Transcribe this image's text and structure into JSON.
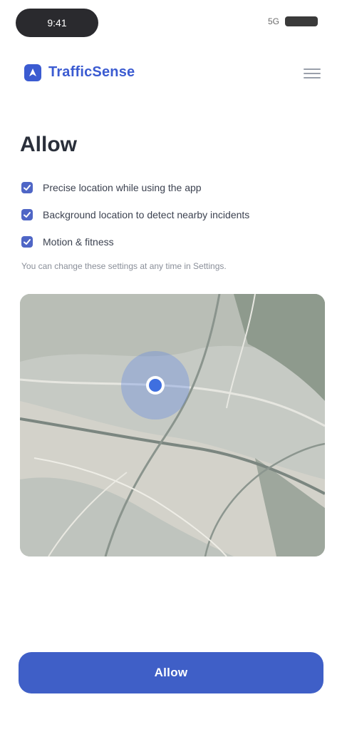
{
  "status_bar": {
    "time": "9:41",
    "signal": "5G"
  },
  "header": {
    "brand_name": "TrafficSense"
  },
  "main": {
    "title": "Allow",
    "permissions": [
      {
        "label": "Precise location while using the app"
      },
      {
        "label": "Background location to detect nearby incidents"
      },
      {
        "label": "Motion & fitness"
      }
    ],
    "note": "You can change these settings at any time in Settings."
  },
  "map": {
    "location_marker": "current-location-icon"
  },
  "actions": {
    "primary_label": "Allow"
  },
  "colors": {
    "accent": "#3f5fc7",
    "brand": "#3b5bd1"
  }
}
